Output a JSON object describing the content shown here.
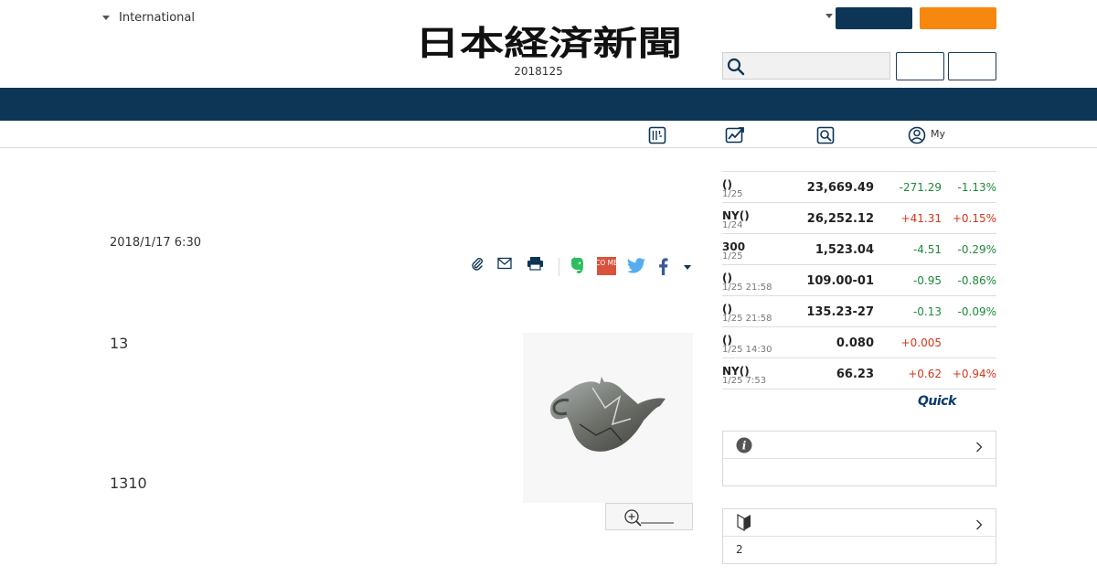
{
  "header": {
    "edition_label": "International",
    "logo_text": "日本経済新聞",
    "date": "2018125",
    "colors": {
      "navy": "#0d3556",
      "orange": "#f6880f"
    }
  },
  "subnav": {
    "icons": [
      "newspaper-icon",
      "chart-icon",
      "search-icon",
      "user-icon"
    ],
    "my_label": "My"
  },
  "article": {
    "date": "2018/1/17 6:30",
    "paragraph1": "13",
    "paragraph2": "1310",
    "share_icons": [
      "clip-icon",
      "mail-icon",
      "print-icon",
      "evernote-icon",
      "come-icon",
      "twitter-icon",
      "facebook-icon"
    ],
    "come_text": "CO ME"
  },
  "market": {
    "rows": [
      {
        "name": "()",
        "date": "1/25",
        "value": "23,669.49",
        "change": "-271.29",
        "pct": "-1.13%",
        "dir": "down"
      },
      {
        "name": "NY()",
        "date": "1/24",
        "value": "26,252.12",
        "change": "+41.31",
        "pct": "+0.15%",
        "dir": "up"
      },
      {
        "name": "300",
        "date": "1/25",
        "value": "1,523.04",
        "change": "-4.51",
        "pct": "-0.29%",
        "dir": "down"
      },
      {
        "name": "()",
        "date": "1/25 21:58",
        "value": "109.00-01",
        "change": "-0.95",
        "pct": "-0.86%",
        "dir": "down"
      },
      {
        "name": "()",
        "date": "1/25 21:58",
        "value": "135.23-27",
        "change": "-0.13",
        "pct": "-0.09%",
        "dir": "down"
      },
      {
        "name": "()",
        "date": "1/25 14:30",
        "value": "0.080",
        "change": "+0.005",
        "pct": "",
        "dir": "up"
      },
      {
        "name": "NY()",
        "date": "1/25 7:53",
        "value": "66.23",
        "change": "+0.62",
        "pct": "+0.94%",
        "dir": "up"
      }
    ],
    "provider": "Quick"
  },
  "sidebar_boxes": {
    "box2_text": "2"
  }
}
